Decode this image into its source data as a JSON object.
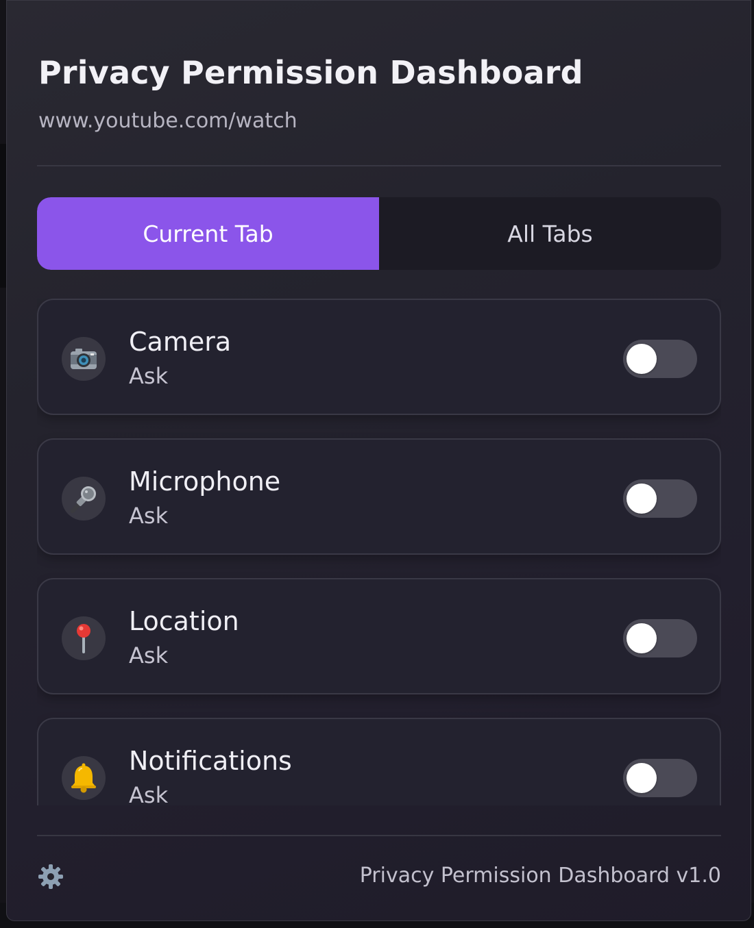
{
  "header": {
    "title": "Privacy Permission Dashboard",
    "url": "www.youtube.com/watch"
  },
  "tabs": [
    {
      "label": "Current Tab",
      "active": true
    },
    {
      "label": "All Tabs",
      "active": false
    }
  ],
  "permissions": [
    {
      "name": "Camera",
      "status": "Ask",
      "icon": "camera-icon",
      "enabled": false
    },
    {
      "name": "Microphone",
      "status": "Ask",
      "icon": "microphone-icon",
      "enabled": false
    },
    {
      "name": "Location",
      "status": "Ask",
      "icon": "location-pin-icon",
      "enabled": false
    },
    {
      "name": "Notifications",
      "status": "Ask",
      "icon": "bell-icon",
      "enabled": false
    }
  ],
  "footer": {
    "settings_icon": "gear-icon",
    "version": "Privacy Permission Dashboard v1.0"
  },
  "colors": {
    "accent": "#8b55ea",
    "background": "#24232d",
    "card": "#23222f",
    "toggle_off": "#4b4a56"
  }
}
